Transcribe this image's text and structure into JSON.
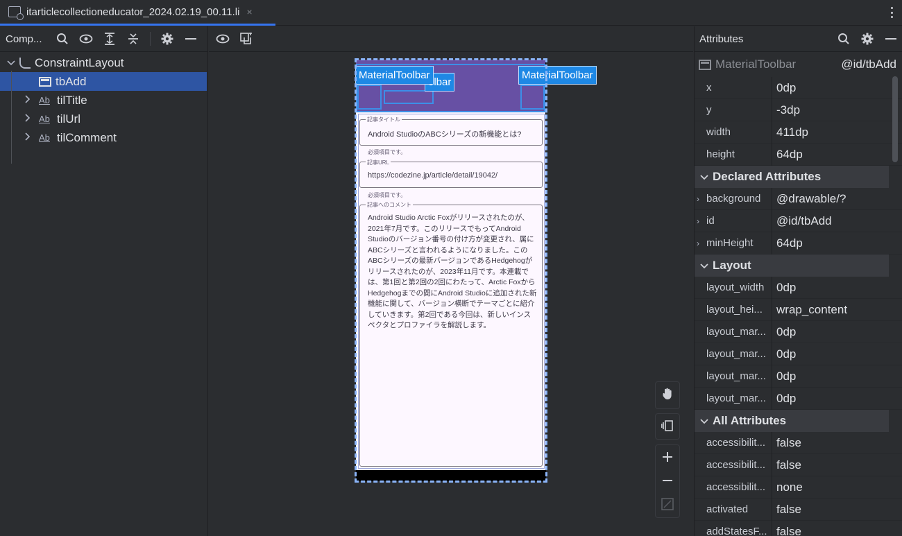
{
  "tab": {
    "title": "itarticlecollectioneducator_2024.02.19_00.11.li",
    "close": "×"
  },
  "component_tree": {
    "header": "Comp...",
    "root": "ConstraintLayout",
    "items": [
      {
        "label": "tbAdd",
        "icon": "toolbar-icon",
        "selected": true
      },
      {
        "label": "tilTitle",
        "icon": "text-icon"
      },
      {
        "label": "tilUrl",
        "icon": "text-icon"
      },
      {
        "label": "tilComment",
        "icon": "text-icon"
      }
    ],
    "ab_glyph": "Ab"
  },
  "canvas": {
    "tags": {
      "left": "MaterialToolbar",
      "middle": "olbar",
      "right": "MaterialToolbar"
    },
    "fields": {
      "title_label": "記事タイトル",
      "title_value": "Android StudioのABCシリーズの新機能とは?",
      "title_helper": "必須項目です。",
      "url_label": "記事URL",
      "url_value": "https://codezine.jp/article/detail/19042/",
      "url_helper": "必須項目です。",
      "comment_label": "記事へのコメント",
      "comment_value": "Android Studio Arctic Foxがリリースされたのが、2021年7月です。このリリースでもってAndroid Studioのバージョン番号の付け方が変更され、属にABCシリーズと言われるようになりました。このABCシリーズの最新バージョンであるHedgehogがリリースされたのが、2023年11月です。本連載では、第1回と第2回の2回にわたって、Arctic FoxからHedgehogまでの間にAndroid Studioに追加された新機能に関して、バージョン横断でテーマごとに紹介していきます。第2回である今回は、新しいインスペクタとプロファイラを解説します。"
    }
  },
  "attributes": {
    "header": "Attributes",
    "component_class": "MaterialToolbar",
    "component_id": "@id/tbAdd",
    "basic": [
      {
        "k": "x",
        "v": "0dp"
      },
      {
        "k": "y",
        "v": "-3dp"
      },
      {
        "k": "width",
        "v": "411dp"
      },
      {
        "k": "height",
        "v": "64dp"
      }
    ],
    "declared_title": "Declared Attributes",
    "declared": [
      {
        "k": "background",
        "v": "@drawable/?"
      },
      {
        "k": "id",
        "v": "@id/tbAdd"
      },
      {
        "k": "minHeight",
        "v": "64dp"
      }
    ],
    "layout_title": "Layout",
    "layout": [
      {
        "k": "layout_width",
        "v": "0dp"
      },
      {
        "k": "layout_hei...",
        "v": "wrap_content"
      },
      {
        "k": "layout_mar...",
        "v": "0dp"
      },
      {
        "k": "layout_mar...",
        "v": "0dp"
      },
      {
        "k": "layout_mar...",
        "v": "0dp"
      },
      {
        "k": "layout_mar...",
        "v": "0dp"
      }
    ],
    "all_title": "All Attributes",
    "all": [
      {
        "k": "accessibilit...",
        "v": "false"
      },
      {
        "k": "accessibilit...",
        "v": "false"
      },
      {
        "k": "accessibilit...",
        "v": "none"
      },
      {
        "k": "activated",
        "v": "false"
      },
      {
        "k": "addStatesF...",
        "v": "false"
      }
    ]
  }
}
